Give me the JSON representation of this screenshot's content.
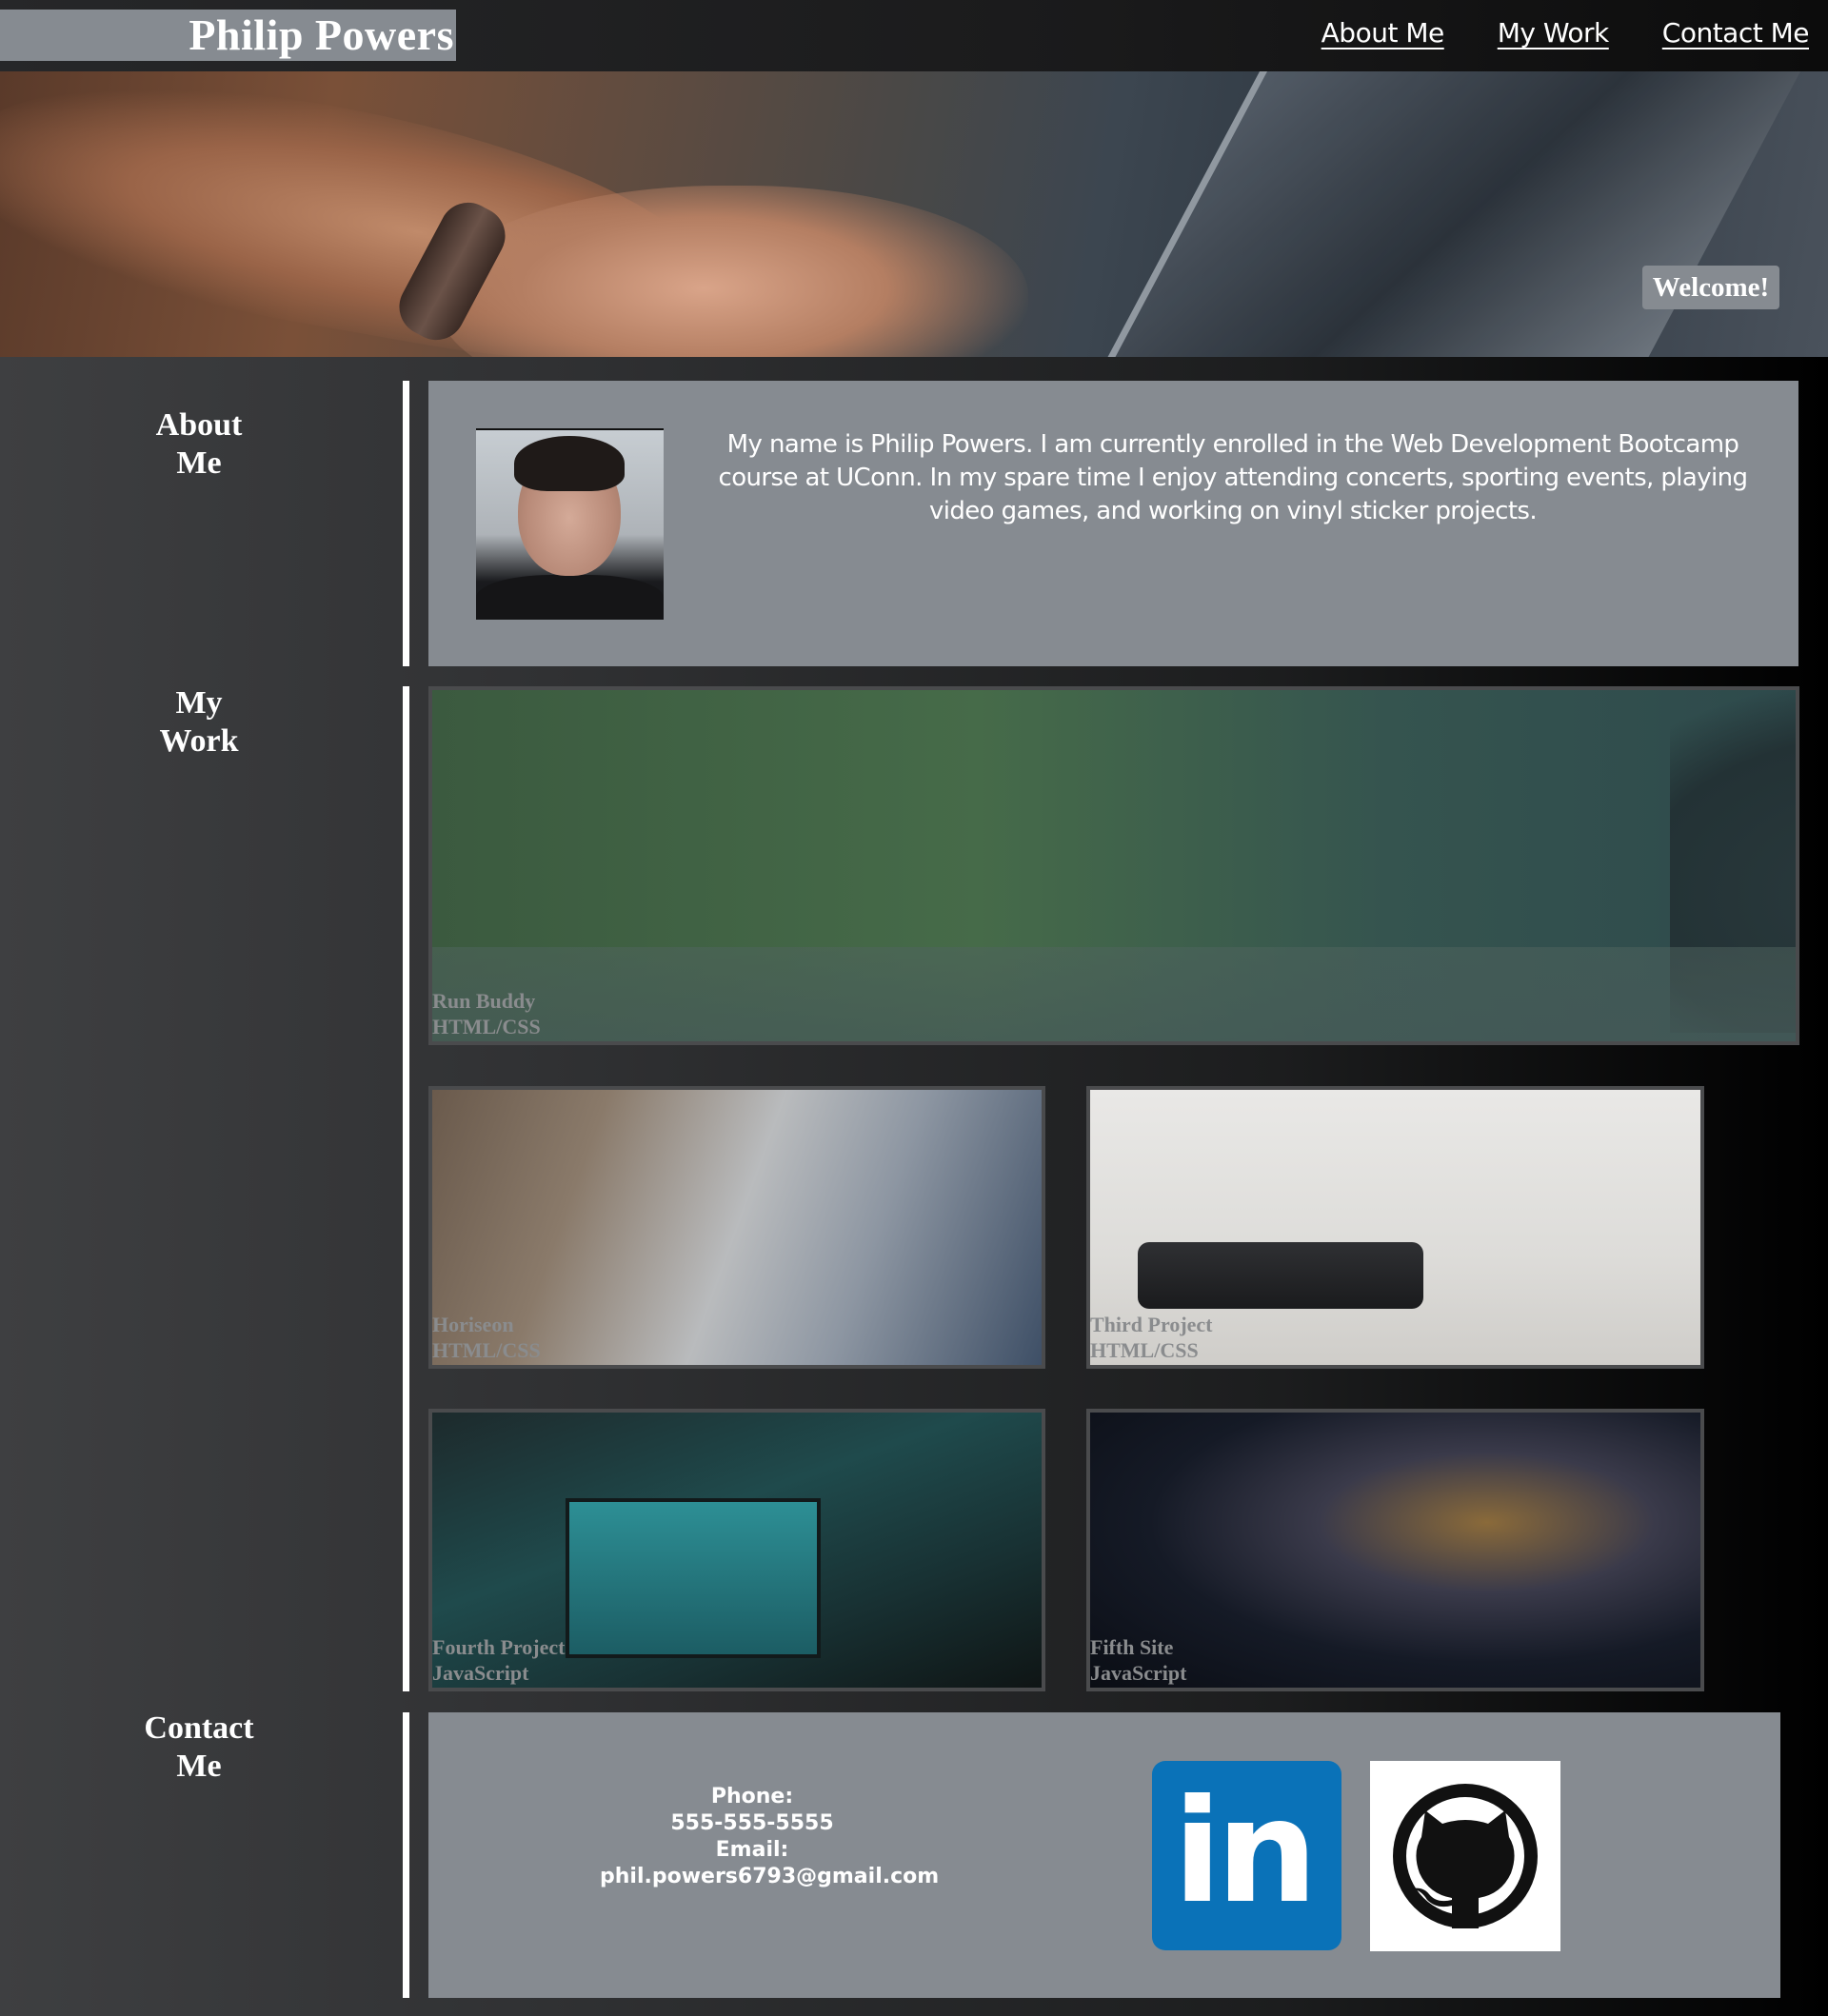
{
  "header": {
    "brand": "Philip Powers",
    "nav": [
      "About Me",
      "My Work",
      "Contact Me"
    ]
  },
  "hero": {
    "welcome": "Welcome!"
  },
  "about": {
    "title": "About Me",
    "text": "My name is Philip Powers. I am currently enrolled in the Web Development Bootcamp course at UConn. In my spare time I enjoy attending concerts, sporting events, playing video games, and working on vinyl sticker projects."
  },
  "work": {
    "title": "My Work",
    "projects": [
      {
        "name": "Run Buddy",
        "tech": "HTML/CSS"
      },
      {
        "name": "Horiseon",
        "tech": "HTML/CSS"
      },
      {
        "name": "Third Project",
        "tech": "HTML/CSS"
      },
      {
        "name": "Fourth Project",
        "tech": "JavaScript"
      },
      {
        "name": "Fifth Site",
        "tech": "JavaScript"
      }
    ]
  },
  "contact": {
    "title": "Contact Me",
    "phone_label": "Phone:",
    "phone": "555-555-5555",
    "email_label": "Email:",
    "email": "phil.powers6793@gmail.com",
    "linkedin_text": "in"
  },
  "colors": {
    "accent_gray": "#868b91",
    "linkedin_blue": "#0a72b8",
    "divider": "#ffffff"
  },
  "icons": [
    "linkedin-icon",
    "github-icon"
  ]
}
